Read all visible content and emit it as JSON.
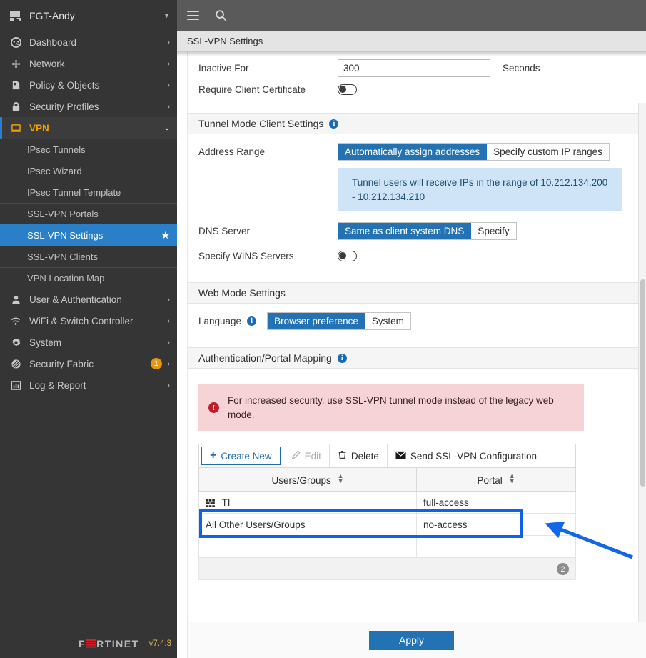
{
  "sidebar": {
    "device": {
      "name": "FGT-Andy",
      "icon": "device-icon",
      "caret": "chevron-down-icon"
    },
    "items": [
      {
        "label": "Dashboard",
        "icon": "dashboard-icon",
        "chevron": "›",
        "state": "collapsed"
      },
      {
        "label": "Network",
        "icon": "network-icon",
        "chevron": "›",
        "state": "collapsed"
      },
      {
        "label": "Policy & Objects",
        "icon": "policy-icon",
        "chevron": "›",
        "state": "collapsed"
      },
      {
        "label": "Security Profiles",
        "icon": "shield-lock-icon",
        "chevron": "›",
        "state": "collapsed"
      },
      {
        "label": "VPN",
        "icon": "monitor-icon",
        "chevron": "⌄",
        "state": "expanded"
      }
    ],
    "vpn_subitems": [
      {
        "label": "IPsec Tunnels",
        "selected": false
      },
      {
        "label": "IPsec Wizard",
        "selected": false
      },
      {
        "label": "IPsec Tunnel Template",
        "selected": false
      },
      {
        "label": "SSL-VPN Portals",
        "selected": false
      },
      {
        "label": "SSL-VPN Settings",
        "selected": true,
        "star": "★"
      },
      {
        "label": "SSL-VPN Clients",
        "selected": false
      },
      {
        "label": "VPN Location Map",
        "selected": false
      }
    ],
    "items_bottom": [
      {
        "label": "User & Authentication",
        "icon": "user-icon",
        "chevron": "›",
        "badge": ""
      },
      {
        "label": "WiFi & Switch Controller",
        "icon": "wifi-icon",
        "chevron": "›",
        "badge": ""
      },
      {
        "label": "System",
        "icon": "gear-icon",
        "chevron": "›",
        "badge": ""
      },
      {
        "label": "Security Fabric",
        "icon": "fabric-icon",
        "chevron": "›",
        "badge": "1"
      },
      {
        "label": "Log & Report",
        "icon": "chart-bar-icon",
        "chevron": "›",
        "badge": ""
      }
    ],
    "footer": {
      "brand_part1": "F",
      "brand_part2": "RTINET",
      "version": "v7.4.3"
    }
  },
  "topbar": {
    "menu_icon": "hamburger-icon",
    "search_icon": "search-icon"
  },
  "breadcrumb": {
    "title": "SSL-VPN Settings"
  },
  "main": {
    "inactive_for": {
      "label": "Inactive For",
      "value": "300",
      "unit": "Seconds"
    },
    "require_client_certificate": {
      "label": "Require Client Certificate",
      "state": "off"
    },
    "tunnel_mode": {
      "section_title": "Tunnel Mode Client Settings",
      "info": "i",
      "address_range": {
        "label": "Address Range",
        "options": [
          "Automatically assign addresses",
          "Specify custom IP ranges"
        ],
        "selected": "Automatically assign addresses"
      },
      "range_note": "Tunnel users will receive IPs in the range of 10.212.134.200 - 10.212.134.210",
      "dns_server": {
        "label": "DNS Server",
        "options": [
          "Same as client system DNS",
          "Specify"
        ],
        "selected": "Same as client system DNS"
      },
      "specify_wins": {
        "label": "Specify WINS Servers",
        "state": "off"
      }
    },
    "web_mode": {
      "section_title": "Web Mode Settings",
      "language": {
        "label": "Language",
        "info": "i",
        "options": [
          "Browser preference",
          "System"
        ],
        "selected": "Browser preference"
      }
    },
    "auth_portal_mapping": {
      "section_title": "Authentication/Portal Mapping",
      "info": "i",
      "warning": "For increased security, use SSL-VPN tunnel mode instead of the legacy web mode.",
      "warning_icon": "!",
      "toolbar": {
        "create_new": "Create New",
        "create_new_icon": "plus-icon",
        "edit": "Edit",
        "edit_icon": "pencil-icon",
        "delete": "Delete",
        "delete_icon": "trash-icon",
        "send_config": "Send SSL-VPN Configuration",
        "send_config_icon": "envelope-icon"
      },
      "table": {
        "columns": [
          "Users/Groups",
          "Portal"
        ],
        "rows": [
          {
            "users_groups": "TI",
            "icon": "user-group-icon",
            "portal": "full-access"
          },
          {
            "users_groups": "All Other Users/Groups",
            "icon": "",
            "portal": "no-access"
          }
        ],
        "row_count": "2"
      }
    }
  },
  "footer": {
    "apply_label": "Apply"
  },
  "annotations": {
    "highlight_box_color": "#1060f0",
    "arrow_color": "#1266e8"
  }
}
